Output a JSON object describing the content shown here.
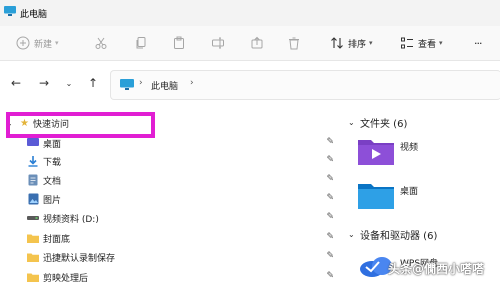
{
  "window": {
    "title": "此电脑"
  },
  "toolbar": {
    "new_label": "新建",
    "sort_label": "排序",
    "view_label": "查看",
    "more_label": "···"
  },
  "address": {
    "path": "此电脑"
  },
  "nav": {
    "quick_access": "快速访问",
    "items": [
      {
        "label": "桌面",
        "icon": "desktop-icon"
      },
      {
        "label": "下载",
        "icon": "download-icon"
      },
      {
        "label": "文档",
        "icon": "document-icon"
      },
      {
        "label": "图片",
        "icon": "picture-icon"
      },
      {
        "label": "视频资料 (D:)",
        "icon": "drive-icon"
      },
      {
        "label": "封面底",
        "icon": "folder-icon"
      },
      {
        "label": "迅捷默认录制保存",
        "icon": "folder-icon"
      },
      {
        "label": "剪映处理后",
        "icon": "folder-icon"
      }
    ]
  },
  "content": {
    "folders_group": "文件夹 (6)",
    "folders": [
      {
        "label": "视频",
        "icon": "video-folder-icon"
      },
      {
        "label": "桌面",
        "icon": "desktop-folder-icon"
      }
    ],
    "devices_group": "设备和驱动器 (6)",
    "device": {
      "label": "WPS网盘"
    }
  },
  "watermark": "头条@僩西小嗒嗒",
  "colors": {
    "highlight": "#e11ed3",
    "folder": "#f4c44e",
    "accent": "#0a84d6"
  }
}
